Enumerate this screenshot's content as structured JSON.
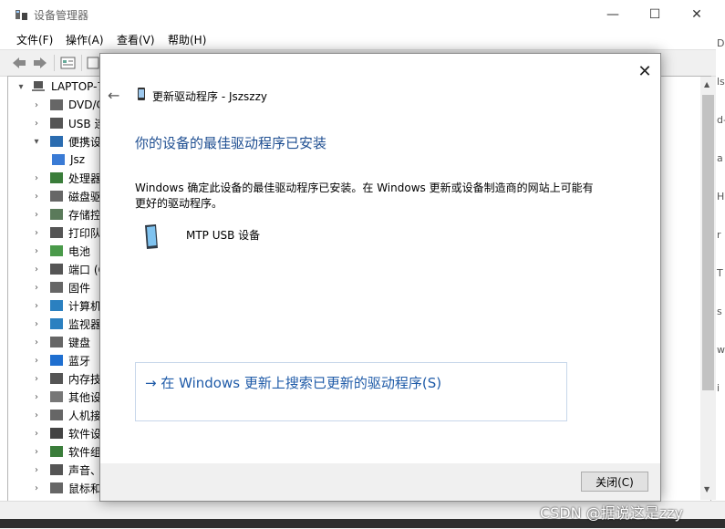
{
  "window": {
    "title": "设备管理器",
    "min": "—",
    "max": "☐",
    "close": "✕"
  },
  "menu": [
    "文件(F)",
    "操作(A)",
    "查看(V)",
    "帮助(H)"
  ],
  "tree": {
    "root": "LAPTOP-7",
    "items": [
      {
        "label": "DVD/C",
        "icon": "dvd-icon"
      },
      {
        "label": "USB 连",
        "icon": "usb-icon"
      },
      {
        "label": "便携设",
        "icon": "portable-device-icon"
      },
      {
        "label": "Jsz",
        "icon": "phone-icon"
      },
      {
        "label": "处理器",
        "icon": "processor-icon"
      },
      {
        "label": "磁盘驱",
        "icon": "disk-icon"
      },
      {
        "label": "存储控",
        "icon": "storage-icon"
      },
      {
        "label": "打印队",
        "icon": "printer-icon"
      },
      {
        "label": "电池",
        "icon": "battery-icon"
      },
      {
        "label": "端口 (C",
        "icon": "port-icon"
      },
      {
        "label": "固件",
        "icon": "firmware-icon"
      },
      {
        "label": "计算机",
        "icon": "computer-icon"
      },
      {
        "label": "监视器",
        "icon": "monitor-icon"
      },
      {
        "label": "键盘",
        "icon": "keyboard-icon"
      },
      {
        "label": "蓝牙",
        "icon": "bluetooth-icon"
      },
      {
        "label": "内存技",
        "icon": "memory-icon"
      },
      {
        "label": "其他设",
        "icon": "other-device-icon"
      },
      {
        "label": "人机接",
        "icon": "hid-icon"
      },
      {
        "label": "软件设",
        "icon": "software-device-icon"
      },
      {
        "label": "软件组",
        "icon": "software-component-icon"
      },
      {
        "label": "声音、",
        "icon": "sound-icon"
      },
      {
        "label": "鼠标和",
        "icon": "mouse-icon"
      }
    ]
  },
  "right_strip": [
    "D",
    "ls",
    "d-",
    "a",
    "H",
    "r",
    "T",
    "s",
    "w",
    "i"
  ],
  "dialog": {
    "title": "更新驱动程序 - Jszszzy",
    "heading": "你的设备的最佳驱动程序已安装",
    "body": "Windows 确定此设备的最佳驱动程序已安装。在 Windows 更新或设备制造商的网站上可能有更好的驱动程序。",
    "device_name": "MTP USB 设备",
    "link": "在 Windows 更新上搜索已更新的驱动程序(S)",
    "close_button": "关闭(C)"
  },
  "watermark": "CSDN @据说这是zzy",
  "colors": {
    "heading": "#1e4e91",
    "link": "#1f5ba8",
    "selection": "#0078d7"
  }
}
